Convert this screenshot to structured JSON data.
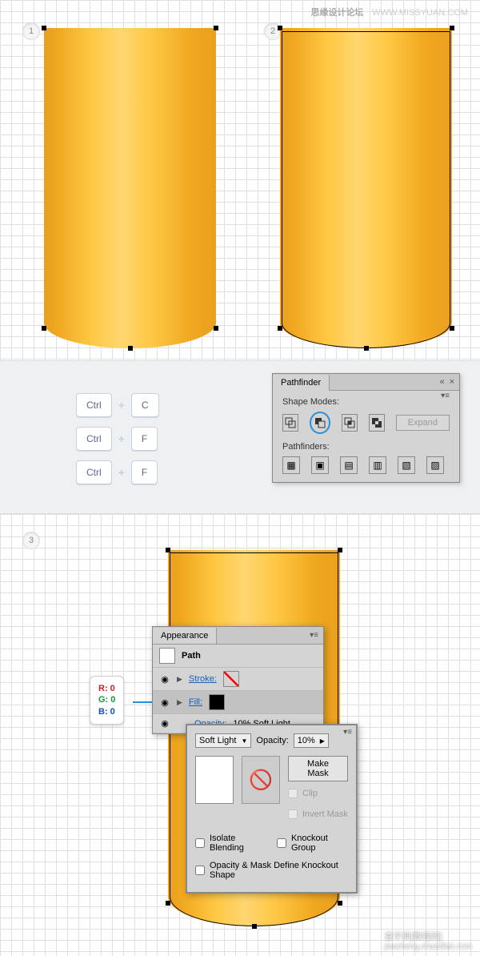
{
  "watermark": {
    "text": "思缘设计论坛",
    "url": "WWW.MISSYUAN.COM"
  },
  "steps": {
    "s1": "1",
    "s2": "2",
    "s3": "3"
  },
  "shortcuts": {
    "row1": {
      "k1": "Ctrl",
      "k2": "C"
    },
    "row2": {
      "k1": "Ctrl",
      "k2": "F"
    },
    "row3": {
      "k1": "Ctrl",
      "k2": "F"
    }
  },
  "pathfinder": {
    "title": "Pathfinder",
    "shape_modes": "Shape Modes:",
    "pathfinders": "Pathfinders:",
    "expand": "Expand"
  },
  "appearance": {
    "title": "Appearance",
    "path": "Path",
    "stroke": "Stroke:",
    "fill": "Fill:",
    "opacity_line": "Opacity:",
    "opacity_val": "10% Soft Light",
    "blend": "Soft Light",
    "opacity_label": "Opacity:",
    "opacity_pct": "10%",
    "make_mask": "Make Mask",
    "clip": "Clip",
    "invert": "Invert Mask",
    "isolate": "Isolate Blending",
    "knockout": "Knockout Group",
    "define": "Opacity & Mask Define Knockout Shape"
  },
  "rgb": {
    "r": "R: 0",
    "g": "G: 0",
    "b": "B: 0"
  },
  "footer": {
    "main": "查字典[教程网]",
    "sub": "jiaocheng.chazidian.com"
  }
}
